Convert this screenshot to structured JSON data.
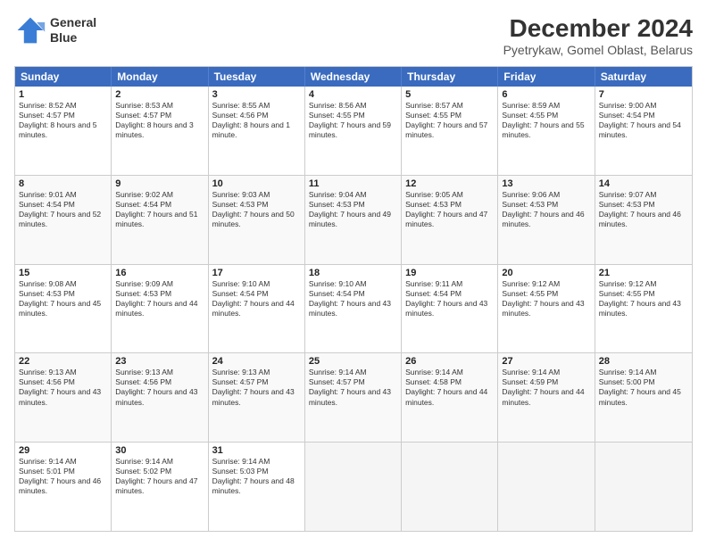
{
  "header": {
    "logo_line1": "General",
    "logo_line2": "Blue",
    "title": "December 2024",
    "subtitle": "Pyetrykaw, Gomel Oblast, Belarus"
  },
  "calendar": {
    "days": [
      "Sunday",
      "Monday",
      "Tuesday",
      "Wednesday",
      "Thursday",
      "Friday",
      "Saturday"
    ],
    "weeks": [
      [
        {
          "num": "",
          "sunrise": "",
          "sunset": "",
          "daylight": "",
          "empty": true
        },
        {
          "num": "2",
          "sunrise": "Sunrise: 8:53 AM",
          "sunset": "Sunset: 4:57 PM",
          "daylight": "Daylight: 8 hours and 3 minutes."
        },
        {
          "num": "3",
          "sunrise": "Sunrise: 8:55 AM",
          "sunset": "Sunset: 4:56 PM",
          "daylight": "Daylight: 8 hours and 1 minute."
        },
        {
          "num": "4",
          "sunrise": "Sunrise: 8:56 AM",
          "sunset": "Sunset: 4:55 PM",
          "daylight": "Daylight: 7 hours and 59 minutes."
        },
        {
          "num": "5",
          "sunrise": "Sunrise: 8:57 AM",
          "sunset": "Sunset: 4:55 PM",
          "daylight": "Daylight: 7 hours and 57 minutes."
        },
        {
          "num": "6",
          "sunrise": "Sunrise: 8:59 AM",
          "sunset": "Sunset: 4:55 PM",
          "daylight": "Daylight: 7 hours and 55 minutes."
        },
        {
          "num": "7",
          "sunrise": "Sunrise: 9:00 AM",
          "sunset": "Sunset: 4:54 PM",
          "daylight": "Daylight: 7 hours and 54 minutes."
        }
      ],
      [
        {
          "num": "8",
          "sunrise": "Sunrise: 9:01 AM",
          "sunset": "Sunset: 4:54 PM",
          "daylight": "Daylight: 7 hours and 52 minutes."
        },
        {
          "num": "9",
          "sunrise": "Sunrise: 9:02 AM",
          "sunset": "Sunset: 4:54 PM",
          "daylight": "Daylight: 7 hours and 51 minutes."
        },
        {
          "num": "10",
          "sunrise": "Sunrise: 9:03 AM",
          "sunset": "Sunset: 4:53 PM",
          "daylight": "Daylight: 7 hours and 50 minutes."
        },
        {
          "num": "11",
          "sunrise": "Sunrise: 9:04 AM",
          "sunset": "Sunset: 4:53 PM",
          "daylight": "Daylight: 7 hours and 49 minutes."
        },
        {
          "num": "12",
          "sunrise": "Sunrise: 9:05 AM",
          "sunset": "Sunset: 4:53 PM",
          "daylight": "Daylight: 7 hours and 47 minutes."
        },
        {
          "num": "13",
          "sunrise": "Sunrise: 9:06 AM",
          "sunset": "Sunset: 4:53 PM",
          "daylight": "Daylight: 7 hours and 46 minutes."
        },
        {
          "num": "14",
          "sunrise": "Sunrise: 9:07 AM",
          "sunset": "Sunset: 4:53 PM",
          "daylight": "Daylight: 7 hours and 46 minutes."
        }
      ],
      [
        {
          "num": "15",
          "sunrise": "Sunrise: 9:08 AM",
          "sunset": "Sunset: 4:53 PM",
          "daylight": "Daylight: 7 hours and 45 minutes."
        },
        {
          "num": "16",
          "sunrise": "Sunrise: 9:09 AM",
          "sunset": "Sunset: 4:53 PM",
          "daylight": "Daylight: 7 hours and 44 minutes."
        },
        {
          "num": "17",
          "sunrise": "Sunrise: 9:10 AM",
          "sunset": "Sunset: 4:54 PM",
          "daylight": "Daylight: 7 hours and 44 minutes."
        },
        {
          "num": "18",
          "sunrise": "Sunrise: 9:10 AM",
          "sunset": "Sunset: 4:54 PM",
          "daylight": "Daylight: 7 hours and 43 minutes."
        },
        {
          "num": "19",
          "sunrise": "Sunrise: 9:11 AM",
          "sunset": "Sunset: 4:54 PM",
          "daylight": "Daylight: 7 hours and 43 minutes."
        },
        {
          "num": "20",
          "sunrise": "Sunrise: 9:12 AM",
          "sunset": "Sunset: 4:55 PM",
          "daylight": "Daylight: 7 hours and 43 minutes."
        },
        {
          "num": "21",
          "sunrise": "Sunrise: 9:12 AM",
          "sunset": "Sunset: 4:55 PM",
          "daylight": "Daylight: 7 hours and 43 minutes."
        }
      ],
      [
        {
          "num": "22",
          "sunrise": "Sunrise: 9:13 AM",
          "sunset": "Sunset: 4:56 PM",
          "daylight": "Daylight: 7 hours and 43 minutes."
        },
        {
          "num": "23",
          "sunrise": "Sunrise: 9:13 AM",
          "sunset": "Sunset: 4:56 PM",
          "daylight": "Daylight: 7 hours and 43 minutes."
        },
        {
          "num": "24",
          "sunrise": "Sunrise: 9:13 AM",
          "sunset": "Sunset: 4:57 PM",
          "daylight": "Daylight: 7 hours and 43 minutes."
        },
        {
          "num": "25",
          "sunrise": "Sunrise: 9:14 AM",
          "sunset": "Sunset: 4:57 PM",
          "daylight": "Daylight: 7 hours and 43 minutes."
        },
        {
          "num": "26",
          "sunrise": "Sunrise: 9:14 AM",
          "sunset": "Sunset: 4:58 PM",
          "daylight": "Daylight: 7 hours and 44 minutes."
        },
        {
          "num": "27",
          "sunrise": "Sunrise: 9:14 AM",
          "sunset": "Sunset: 4:59 PM",
          "daylight": "Daylight: 7 hours and 44 minutes."
        },
        {
          "num": "28",
          "sunrise": "Sunrise: 9:14 AM",
          "sunset": "Sunset: 5:00 PM",
          "daylight": "Daylight: 7 hours and 45 minutes."
        }
      ],
      [
        {
          "num": "29",
          "sunrise": "Sunrise: 9:14 AM",
          "sunset": "Sunset: 5:01 PM",
          "daylight": "Daylight: 7 hours and 46 minutes."
        },
        {
          "num": "30",
          "sunrise": "Sunrise: 9:14 AM",
          "sunset": "Sunset: 5:02 PM",
          "daylight": "Daylight: 7 hours and 47 minutes."
        },
        {
          "num": "31",
          "sunrise": "Sunrise: 9:14 AM",
          "sunset": "Sunset: 5:03 PM",
          "daylight": "Daylight: 7 hours and 48 minutes."
        },
        {
          "num": "",
          "sunrise": "",
          "sunset": "",
          "daylight": "",
          "empty": true
        },
        {
          "num": "",
          "sunrise": "",
          "sunset": "",
          "daylight": "",
          "empty": true
        },
        {
          "num": "",
          "sunrise": "",
          "sunset": "",
          "daylight": "",
          "empty": true
        },
        {
          "num": "",
          "sunrise": "",
          "sunset": "",
          "daylight": "",
          "empty": true
        }
      ]
    ],
    "week1_day1": {
      "num": "1",
      "sunrise": "Sunrise: 8:52 AM",
      "sunset": "Sunset: 4:57 PM",
      "daylight": "Daylight: 8 hours and 5 minutes."
    }
  }
}
